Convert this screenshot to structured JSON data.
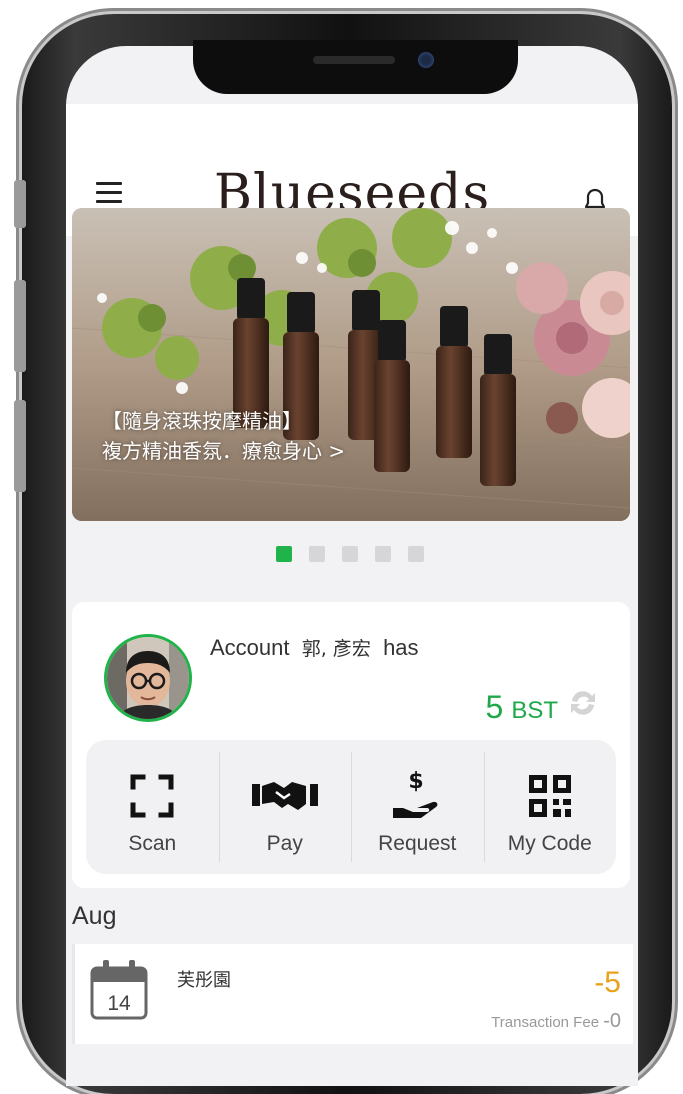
{
  "header": {
    "brand": "Blueseeds"
  },
  "banner": {
    "line1": "【隨身滾珠按摩精油】",
    "line2": "複方精油香氛．療愈身心 >"
  },
  "carousel": {
    "count": 5,
    "active_index": 0
  },
  "account": {
    "prefix": "Account",
    "name": "郭, 彥宏",
    "suffix": "has",
    "balance": "5",
    "unit": "BST"
  },
  "actions": [
    {
      "label": "Scan",
      "icon": "scan-icon"
    },
    {
      "label": "Pay",
      "icon": "handshake-icon"
    },
    {
      "label": "Request",
      "icon": "request-money-icon"
    },
    {
      "label": "My Code",
      "icon": "qr-code-icon"
    }
  ],
  "history": {
    "month": "Aug",
    "items": [
      {
        "day": "14",
        "title": "芙彤園",
        "amount": "-5",
        "fee_label": "Transaction Fee",
        "fee_value": "-0"
      }
    ]
  },
  "colors": {
    "accent_green": "#1fb34a",
    "amount_orange": "#e8a21a"
  }
}
